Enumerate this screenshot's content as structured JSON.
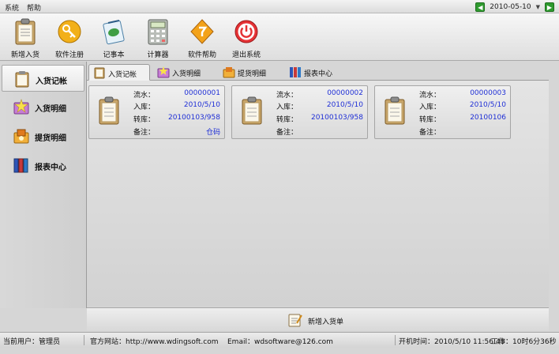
{
  "menubar": {
    "items": [
      "系统",
      "帮助"
    ],
    "date": "2010-05-10"
  },
  "toolbar": {
    "buttons": [
      {
        "label": "新增入货",
        "icon": "clipboard-icon"
      },
      {
        "label": "软件注册",
        "icon": "key-icon"
      },
      {
        "label": "记事本",
        "icon": "notepad-icon"
      },
      {
        "label": "计算器",
        "icon": "calculator-icon"
      },
      {
        "label": "软件帮助",
        "icon": "help-diamond-icon"
      },
      {
        "label": "退出系统",
        "icon": "power-icon"
      }
    ]
  },
  "sidebar": {
    "items": [
      {
        "label": "入货记帐",
        "icon": "clipboard-icon",
        "active": true
      },
      {
        "label": "入货明细",
        "icon": "star-folder-icon"
      },
      {
        "label": "提货明细",
        "icon": "box-folder-icon"
      },
      {
        "label": "报表中心",
        "icon": "books-icon"
      }
    ]
  },
  "tabs": [
    {
      "label": "入货记帐",
      "icon": "clipboard-icon"
    },
    {
      "label": "入货明细",
      "icon": "star-folder-icon"
    },
    {
      "label": "提货明细",
      "icon": "box-folder-icon"
    },
    {
      "label": "报表中心",
      "icon": "books-icon"
    }
  ],
  "cards": [
    {
      "flow_label": "流水：",
      "flow": "00000001",
      "in_label": "入库：",
      "in": "2010/5/10",
      "transfer_label": "转库：",
      "transfer": "20100103/958",
      "note_label": "备注：",
      "note": "仓码"
    },
    {
      "flow_label": "流水：",
      "flow": "00000002",
      "in_label": "入库：",
      "in": "2010/5/10",
      "transfer_label": "转库：",
      "transfer": "20100103/958",
      "note_label": "备注：",
      "note": ""
    },
    {
      "flow_label": "流水：",
      "flow": "00000003",
      "in_label": "入库：",
      "in": "2010/5/10",
      "transfer_label": "转库：",
      "transfer": "20100106",
      "note_label": "备注：",
      "note": ""
    }
  ],
  "bottom": {
    "add_order_label": "新增入货单"
  },
  "status": {
    "user": "当前用户：管理员",
    "website": "官方网站：http://www.wdingsoft.com",
    "email": "Email：wdsoftware@126.com",
    "start_time": "开机时间：2010/5/10 11:56:48",
    "work_time": "工作：10时6分36秒"
  },
  "colors": {
    "value_blue": "#1f2fd6",
    "nav_green": "#2f9a2f"
  }
}
